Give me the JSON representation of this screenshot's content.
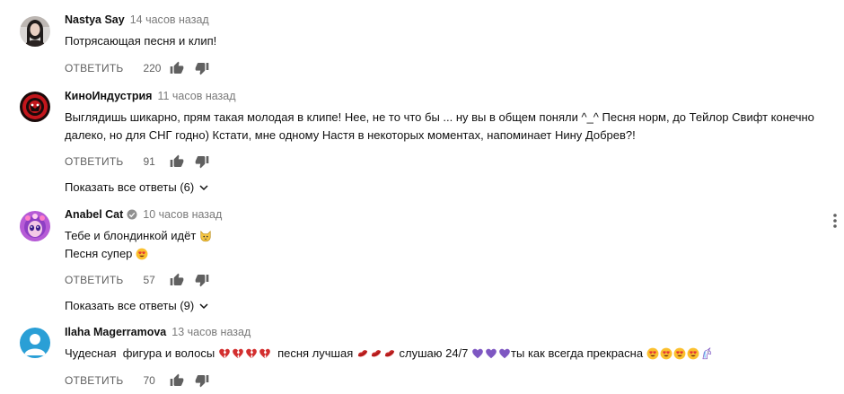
{
  "labels": {
    "reply": "ОТВЕТИТЬ"
  },
  "comments": [
    {
      "author": "Nastya Say",
      "time": "14 часов назад",
      "lines": [
        "Потрясающая песня и клип!"
      ],
      "likes": "220",
      "avatar": "photo-avatar"
    },
    {
      "author": "КиноИндустрия",
      "time": "11 часов назад",
      "lines": [
        "Выглядишь шикарно, прям такая молодая в клипе! Нее, не то что бы ... ну вы в общем поняли ^_^ Песня норм, до Тейлор Свифт конечно",
        "далеко, но для СНГ годно) Кстати, мне одному Настя в некоторых моментах, напоминает Нину Добрев?!"
      ],
      "likes": "91",
      "show_replies": "Показать все ответы (6)",
      "avatar": "red-logo-avatar"
    },
    {
      "author": "Anabel Cat",
      "time": "10 часов назад",
      "lines": [
        "Тебе и блондинкой идёт",
        "Песня супер"
      ],
      "likes": "57",
      "show_replies": "Показать все ответы (9)",
      "avatar": "cartoon-avatar",
      "verified": true
    },
    {
      "author": "Ilaha Magerramova",
      "time": "13 часов назад",
      "text_parts": [
        "Чудесная  фигура и волосы",
        "  песня лучшая",
        " слушаю 24/7",
        "ты как всегда прекрасна"
      ],
      "likes": "70",
      "avatar": "default-user-avatar"
    }
  ],
  "colors": {
    "text": "#111111",
    "meta": "#7a7a7a",
    "icon": "#606060",
    "default_avatar_bg": "#2a9fd6"
  }
}
